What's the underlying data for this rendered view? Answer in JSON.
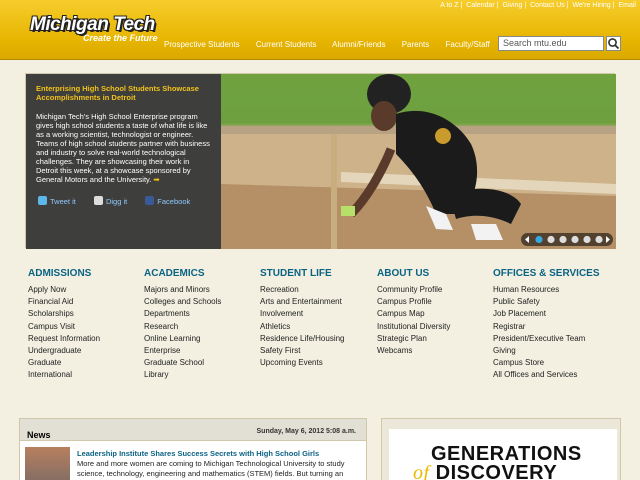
{
  "header": {
    "logo_main": "Michigan Tech",
    "logo_tag": "Create the Future",
    "utility": [
      "A to Z",
      "Calendar",
      "Giving",
      "Contact Us",
      "We're Hiring",
      "Email"
    ],
    "nav": [
      "Prospective Students",
      "Current Students",
      "Alumni/Friends",
      "Parents",
      "Faculty/Staff"
    ],
    "search_placeholder": "Search mtu.edu",
    "brand_color": "#f2c21a"
  },
  "hero": {
    "title": "Enterprising High School Students Showcase Accomplishments in Detroit",
    "body": "Michigan Tech's High School Enterprise program gives high school students a taste of what life is like as a working scientist, technologist or engineer. Teams of high school students partner with business and industry to solve real-world technological challenges. They are showcasing their work in Detroit this week, at a showcase sponsored by General Motors and the University.",
    "arrow": "➡",
    "share": {
      "tweet": "Tweet it",
      "digg": "Digg it",
      "facebook": "Facebook"
    },
    "slides": {
      "count": 6,
      "active": 1
    }
  },
  "columns": [
    {
      "heading": "ADMISSIONS",
      "items": [
        "Apply Now",
        "Financial Aid",
        "Scholarships",
        "Campus Visit",
        "Request Information",
        "Undergraduate",
        "Graduate",
        "International"
      ]
    },
    {
      "heading": "ACADEMICS",
      "items": [
        "Majors and Minors",
        "Colleges and Schools",
        "Departments",
        "Research",
        "Online Learning",
        "Enterprise",
        "Graduate School",
        "Library"
      ]
    },
    {
      "heading": "STUDENT LIFE",
      "items": [
        "Recreation",
        "Arts and Entertainment",
        "Involvement",
        "Athletics",
        "Residence Life/Housing",
        "Safety First",
        "Upcoming Events"
      ]
    },
    {
      "heading": "ABOUT US",
      "items": [
        "Community Profile",
        "Campus Profile",
        "Campus Map",
        "Institutional Diversity",
        "Strategic Plan",
        "Webcams"
      ]
    },
    {
      "heading": "OFFICES & SERVICES",
      "items": [
        "Human Resources",
        "Public Safety",
        "Job Placement",
        "Registrar",
        "President/Executive Team",
        "Giving",
        "Campus Store",
        "All Offices and Services"
      ]
    }
  ],
  "news": {
    "title": "News",
    "date": "Sunday, May 6, 2012 5:08 a.m.",
    "headline": "Leadership Institute Shares Success Secrets with High School Girls",
    "body": "More and more women are coming to Michigan Technological University to study science, technology, engineering and mathematics (STEM) fields.  But turning an"
  },
  "promo": {
    "line1": "GENERATIONS",
    "line2_prefix": "of",
    "line2": "DISCOVERY"
  }
}
